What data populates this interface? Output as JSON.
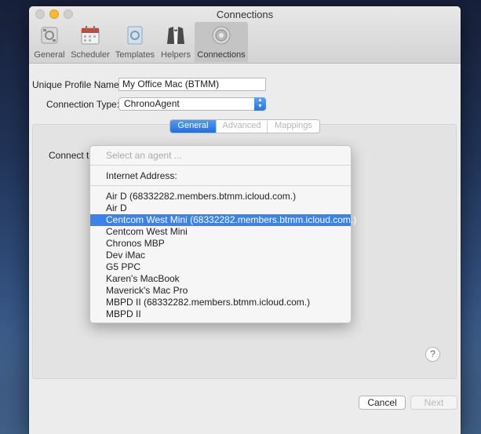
{
  "window": {
    "title": "Connections"
  },
  "toolbar": [
    {
      "label": "General",
      "icon": "general-icon"
    },
    {
      "label": "Scheduler",
      "icon": "calendar-icon"
    },
    {
      "label": "Templates",
      "icon": "templates-icon"
    },
    {
      "label": "Helpers",
      "icon": "tuxedo-icon"
    },
    {
      "label": "Connections",
      "icon": "connections-icon",
      "active": true
    }
  ],
  "form": {
    "profile_label": "Unique Profile Name:",
    "profile_value": "My Office Mac (BTMM)",
    "type_label": "Connection Type:",
    "type_value": "ChronoAgent"
  },
  "tabs": [
    {
      "label": "General",
      "selected": true
    },
    {
      "label": "Advanced",
      "selected": false
    },
    {
      "label": "Mappings",
      "selected": false
    }
  ],
  "connect_label": "Connect to",
  "dropdown": {
    "placeholder": "Select an agent ...",
    "internet_address": "Internet Address:",
    "items": [
      "Air D (68332282.members.btmm.icloud.com.)",
      "Air D",
      "Centcom West Mini (68332282.members.btmm.icloud.com.)",
      "Centcom West Mini",
      "Chronos MBP",
      "Dev iMac",
      "G5 PPC",
      "Karen's MacBook",
      "Maverick's Mac Pro",
      "MBPD II (68332282.members.btmm.icloud.com.)",
      "MBPD II"
    ],
    "highlighted": "Centcom West Mini (68332282.members.btmm.icloud.com.)"
  },
  "help_label": "?",
  "buttons": {
    "cancel": "Cancel",
    "next": "Next"
  },
  "colors": {
    "accent": "#2b74e4",
    "highlight": "#3b83ea"
  }
}
